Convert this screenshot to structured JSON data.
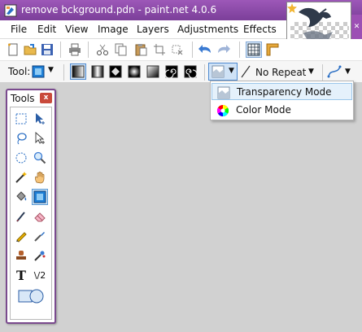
{
  "window": {
    "title": "remove bckground.pdn - paint.net 4.0.6"
  },
  "menu": {
    "items": [
      "File",
      "Edit",
      "View",
      "Image",
      "Layers",
      "Adjustments",
      "Effects"
    ]
  },
  "toolbar": {
    "tool_label": "Tool:",
    "repeat_label": "No Repeat"
  },
  "tools_window": {
    "title": "Tools",
    "close_label": "x",
    "text_tool_glyph": "T",
    "line_tool_glyph": "\\/2"
  },
  "dropdown": {
    "items": [
      {
        "label": "Transparency Mode",
        "icon": "transparency-icon"
      },
      {
        "label": "Color Mode",
        "icon": "color-wheel-icon"
      }
    ],
    "highlighted": "Transparency Mode"
  },
  "colors": {
    "titlebar": "#8b4aa8",
    "highlight": "#e5f1fb",
    "workspace": "#d1d1d1"
  }
}
